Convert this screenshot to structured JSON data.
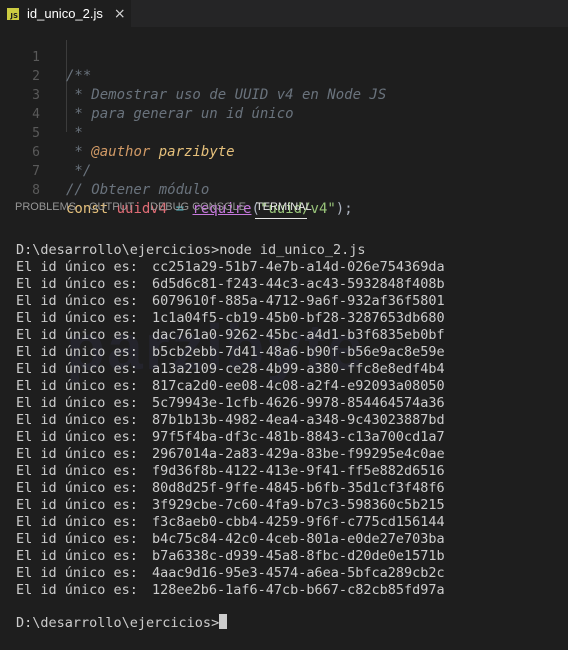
{
  "tab": {
    "badge": "JS",
    "title": "id_unico_2.js",
    "close": "×"
  },
  "editor": {
    "line_numbers": [
      "1",
      "2",
      "3",
      "4",
      "5",
      "6",
      "7",
      "8"
    ],
    "lines": {
      "l1": "/**",
      "l2": " * Demostrar uso de UUID v4 en Node JS",
      "l3": " * para generar un id único",
      "l4": " *",
      "l5_prefix": " * ",
      "l5_tag": "@author",
      "l5_value": " parzibyte",
      "l6": " */",
      "l7": "// Obtener módulo",
      "l8_kw": "const",
      "l8_var": "uuidv4",
      "l8_eq": "=",
      "l8_fn": "require",
      "l8_open": "(",
      "l8_str": "\"uuid/v4\"",
      "l8_close": ");"
    }
  },
  "panel_tabs": [
    "PROBLEMS",
    "OUTPUT",
    "DEBUG CONSOLE",
    "TERMINAL"
  ],
  "terminal": {
    "watermark": "parzibyte",
    "command": "D:\\desarrollo\\ejercicios>node id_unico_2.js",
    "label": "El id único es:",
    "ids": [
      "cc251a29-51b7-4e7b-a14d-026e754369da",
      "6d5d6c81-f243-44c3-ac43-5932848f408b",
      "6079610f-885a-4712-9a6f-932af36f5801",
      "1c1a04f5-cb19-45b0-bf28-3287653db680",
      "dac761a0-9262-45bc-a4d1-b3f6835eb0bf",
      "b5cb2ebb-7d41-48a6-b90f-b56e9ac8e59e",
      "a13a2109-ce28-4b99-a380-ffc8e8edf4b4",
      "817ca2d0-ee08-4c08-a2f4-e92093a08050",
      "5c79943e-1cfb-4626-9978-854464574a36",
      "87b1b13b-4982-4ea4-a348-9c43023887bd",
      "97f5f4ba-df3c-481b-8843-c13a700cd1a7",
      "2967014a-2a83-429a-83be-f99295e4c0ae",
      "f9d36f8b-4122-413e-9f41-ff5e882d6516",
      "80d8d25f-9ffe-4845-b6fb-35d1cf3f48f6",
      "3f929cbe-7c60-4fa9-b7c3-598360c5b215",
      "f3c8aeb0-cbb4-4259-9f6f-c775cd156144",
      "b4c75c84-42c0-4ceb-801a-e0de27e703ba",
      "b7a6338c-d939-45a8-8fbc-d20de0e1571b",
      "4aac9d16-95e3-4574-a6ea-5bfca289cb2c",
      "128ee2b6-1af6-47cb-b667-c82cb85fd97a"
    ],
    "prompt": "D:\\desarrollo\\ejercicios>"
  }
}
